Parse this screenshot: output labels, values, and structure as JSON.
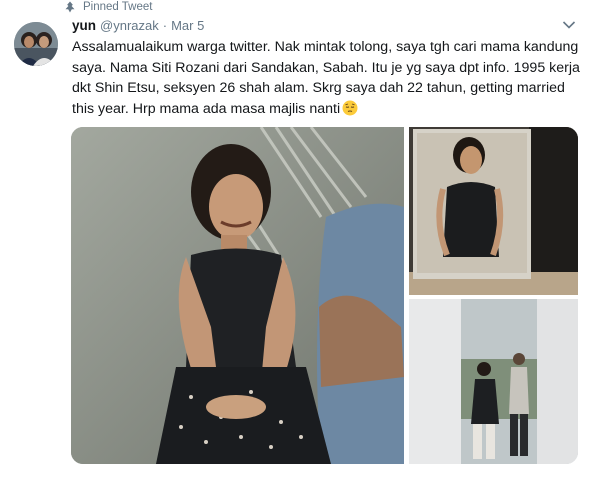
{
  "pinned": {
    "label": "Pinned Tweet",
    "icon": "pin-icon"
  },
  "author": {
    "name": "yun",
    "handle": "@ynrazak",
    "separator": "·",
    "date": "Mar 5",
    "avatar_icon": "avatar"
  },
  "tweet": {
    "text": "Assalamualaikum warga twitter. Nak mintak tolong, saya tgh cari mama kandung saya. Nama Siti Rozani dari Sandakan, Sabah. Itu je yg saya dpt info. 1995 kerja dkt Shin Etsu, seksyen 26 shah alam. Skrg saya dah 22 tahun, getting married this year. Hrp mama ada masa majlis nanti",
    "emoji": "pensive-face-emoji"
  },
  "menu": {
    "icon": "chevron-down-icon"
  },
  "media": {
    "photos": [
      "photo-woman-seated",
      "photo-woman-standing-polaroid",
      "photo-two-people-standing"
    ]
  },
  "colors": {
    "secondary_text": "#657786",
    "primary_text": "#14171a",
    "background": "#ffffff"
  }
}
